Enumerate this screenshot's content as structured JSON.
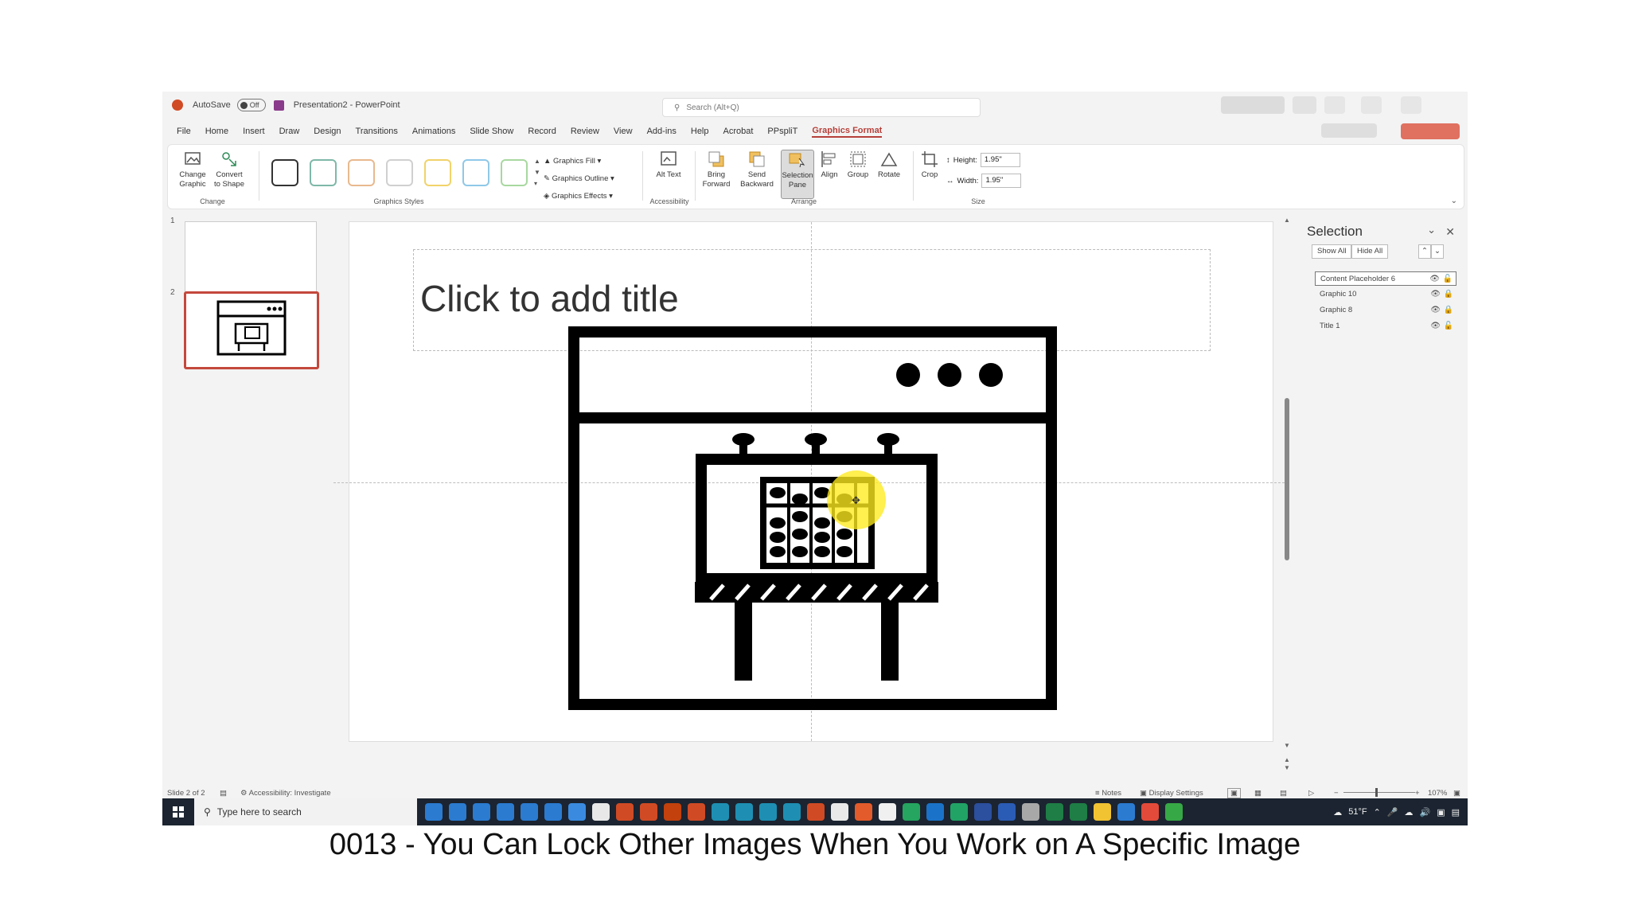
{
  "titlebar": {
    "autosave_label": "AutoSave",
    "autosave_state": "Off",
    "doc_title": "Presentation2 - PowerPoint",
    "search_placeholder": "Search (Alt+Q)"
  },
  "menu": {
    "tabs": [
      "File",
      "Home",
      "Insert",
      "Draw",
      "Design",
      "Transitions",
      "Animations",
      "Slide Show",
      "Record",
      "Review",
      "View",
      "Add-ins",
      "Help",
      "Acrobat",
      "PPspliT",
      "Graphics Format"
    ],
    "active_tab": "Graphics Format"
  },
  "ribbon": {
    "change_graphic": "Change Graphic",
    "convert_to_shape": "Convert to Shape",
    "group_change": "Change",
    "group_styles": "Graphics Styles",
    "graphics_fill": "Graphics Fill",
    "graphics_outline": "Graphics Outline",
    "graphics_effects": "Graphics Effects",
    "alt_text": "Alt Text",
    "group_accessibility": "Accessibility",
    "bring_forward": "Bring Forward",
    "send_backward": "Send Backward",
    "selection_pane": "Selection Pane",
    "align": "Align",
    "group": "Group",
    "rotate": "Rotate",
    "group_arrange": "Arrange",
    "crop": "Crop",
    "height_label": "Height:",
    "height_value": "1.95\"",
    "width_label": "Width:",
    "width_value": "1.95\"",
    "group_size": "Size"
  },
  "slides": {
    "numbers": [
      "1",
      "2"
    ],
    "selected_index": 2
  },
  "canvas": {
    "title_placeholder": "Click to add title"
  },
  "selection_pane": {
    "title": "Selection",
    "show_all": "Show All",
    "hide_all": "Hide All",
    "items": [
      {
        "name": "Content Placeholder 6",
        "visible": true,
        "locked": false
      },
      {
        "name": "Graphic 10",
        "visible": true,
        "locked": true
      },
      {
        "name": "Graphic 8",
        "visible": true,
        "locked": true
      },
      {
        "name": "Title 1",
        "visible": true,
        "locked": false
      }
    ]
  },
  "statusbar": {
    "slide_info": "Slide 2 of 2",
    "accessibility": "Accessibility: Investigate",
    "notes": "Notes",
    "display_settings": "Display Settings",
    "zoom": "107%"
  },
  "taskbar": {
    "search_placeholder": "Type here to search",
    "weather": "51°F"
  },
  "caption": "0013 - You Can Lock Other Images When You Work on A Specific Image",
  "colors": {
    "accent": "#b6403a",
    "taskbar": "#1b2430",
    "cursor_highlight": "#ffeb1e"
  }
}
